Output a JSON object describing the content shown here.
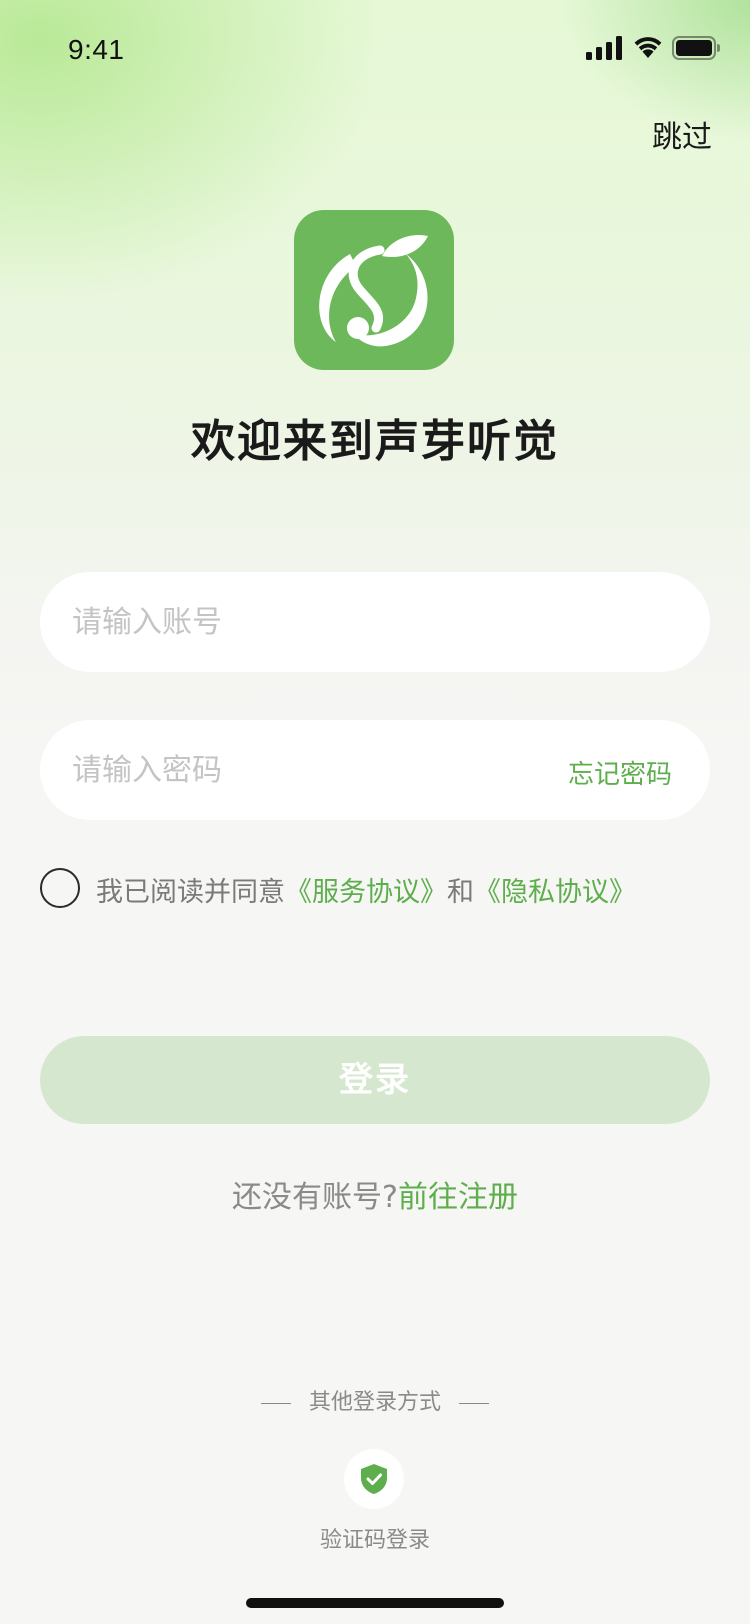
{
  "status_bar": {
    "time": "9:41",
    "icons": [
      "signal-icon",
      "wifi-icon",
      "battery-icon"
    ]
  },
  "header": {
    "skip_label": "跳过"
  },
  "logo": {
    "icon": "app-logo-s-leaf",
    "brand_color": "#6db85b"
  },
  "welcome": {
    "title": "欢迎来到声芽听觉"
  },
  "form": {
    "account_placeholder": "请输入账号",
    "account_value": "",
    "password_placeholder": "请输入密码",
    "password_value": "",
    "forgot_password_label": "忘记密码"
  },
  "agreement": {
    "checked": false,
    "prefix": "我已阅读并同意",
    "service_link": "《服务协议》",
    "conjunction": "和",
    "privacy_link": "《隐私协议》"
  },
  "login": {
    "button_label": "登录",
    "button_color": "#d5e8cf"
  },
  "register": {
    "prompt": "还没有账号?",
    "link_label": "前往注册"
  },
  "other_login": {
    "divider_label": "其他登录方式",
    "methods": [
      {
        "label": "验证码登录",
        "icon": "shield-check-icon"
      }
    ]
  },
  "colors": {
    "accent": "#5fae4d",
    "text_primary": "#1a1a1a",
    "text_secondary": "#8a8a8a",
    "placeholder": "#c4c4c4"
  }
}
